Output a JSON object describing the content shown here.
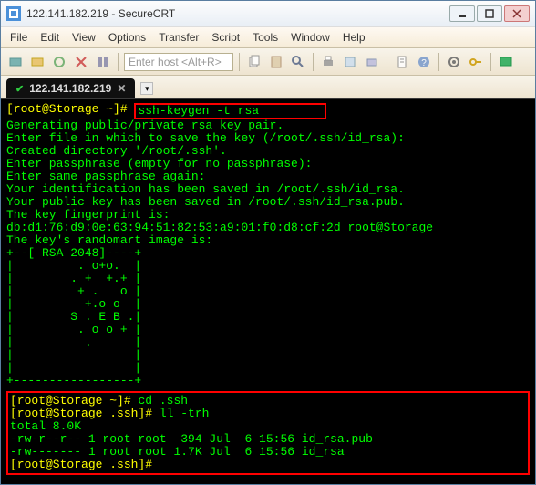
{
  "title": "122.141.182.219 - SecureCRT",
  "menubar": [
    "File",
    "Edit",
    "View",
    "Options",
    "Transfer",
    "Script",
    "Tools",
    "Window",
    "Help"
  ],
  "host_placeholder": "Enter host <Alt+R>",
  "tab": {
    "label": "122.141.182.219"
  },
  "term": {
    "p1_prompt": "[root@Storage ~]# ",
    "p1_cmd": "ssh-keygen -t rsa",
    "l1": "Generating public/private rsa key pair.",
    "l2": "Enter file in which to save the key (/root/.ssh/id_rsa):",
    "l3": "Created directory '/root/.ssh'.",
    "l4": "Enter passphrase (empty for no passphrase):",
    "l5": "Enter same passphrase again:",
    "l6": "Your identification has been saved in /root/.ssh/id_rsa.",
    "l7": "Your public key has been saved in /root/.ssh/id_rsa.pub.",
    "l8": "The key fingerprint is:",
    "l9": "db:d1:76:d9:0e:63:94:51:82:53:a9:01:f0:d8:cf:2d root@Storage",
    "l10": "The key's randomart image is:",
    "art": "+--[ RSA 2048]----+\n|         . o+o.  |\n|        . +  +.+ |\n|         + .   o |\n|          +.o o  |\n|        S . E B .|\n|         . o o + |\n|          .      |\n|                 |\n|                 |\n+-----------------+",
    "p2_prompt": "[root@Storage ~]# ",
    "p2_cmd": "cd .ssh",
    "p3_prompt": "[root@Storage .ssh]# ",
    "p3_cmd": "ll -trh",
    "ls1": "total 8.0K",
    "ls2": "-rw-r--r-- 1 root root  394 Jul  6 15:56 id_rsa.pub",
    "ls3": "-rw------- 1 root root 1.7K Jul  6 15:56 id_rsa",
    "p4_prompt": "[root@Storage .ssh]#"
  }
}
